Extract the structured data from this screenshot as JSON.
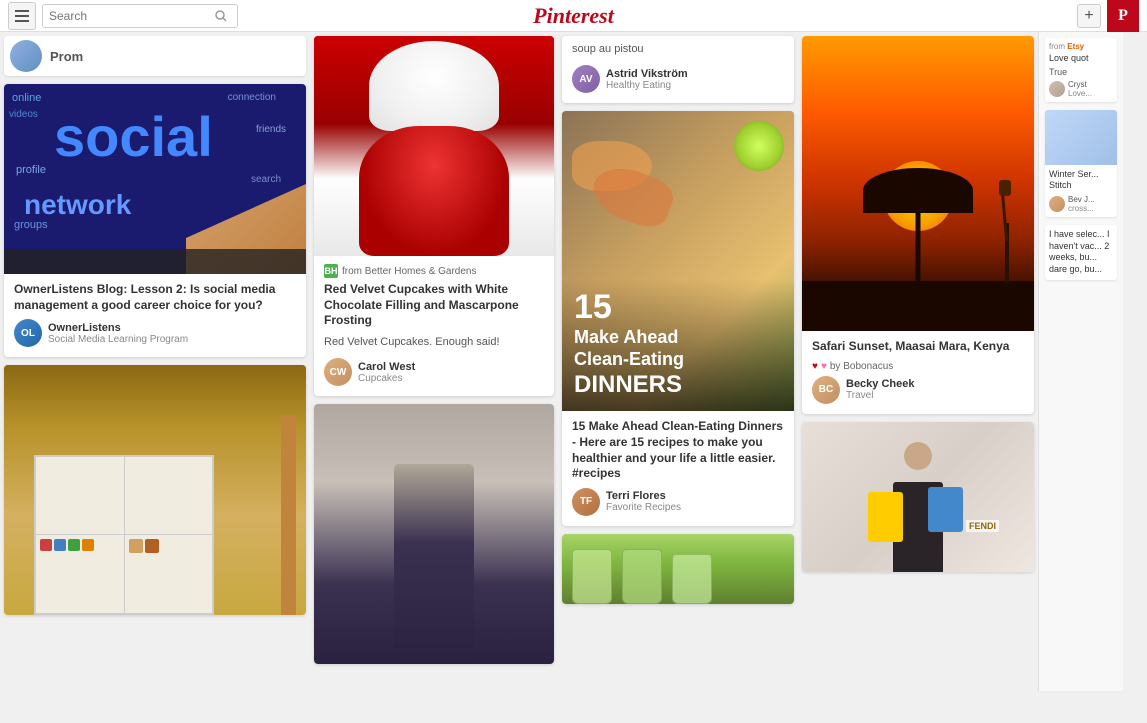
{
  "nav": {
    "search_placeholder": "Search",
    "logo": "Pinterest",
    "logo_stylized": "Pinterest"
  },
  "prom_user": {
    "name": "Prom"
  },
  "col1": {
    "card1": {
      "title": "OwnerListens Blog: Lesson 2: Is social media management a good career choice for you?",
      "user_name": "OwnerListens",
      "user_board": "Social Media Learning Program"
    }
  },
  "col2": {
    "card1": {
      "source_from": "from",
      "source_name": "Better Homes & Gardens",
      "title": "Red Velvet Cupcakes with White Chocolate Filling and Mascarpone Frosting",
      "desc": "Red Velvet Cupcakes. Enough said!",
      "user_name": "Carol West",
      "user_board": "Cupcakes"
    }
  },
  "col3": {
    "card0": {
      "text": "soup au pistou"
    },
    "card0_user": {
      "name": "Astrid Vikström",
      "board": "Healthy Eating"
    },
    "card1": {
      "shrimp_num": "15",
      "shrimp_label": "Make Ahead\nClean-Eating\nDINNERS",
      "title": "15 Make Ahead Clean-Eating Dinners - Here are 15 recipes to make you healthier and your life a little easier. #recipes",
      "user_name": "Terri Flores",
      "user_board": "Favorite Recipes"
    },
    "card2": {
      "text": "jars"
    }
  },
  "col4": {
    "card1": {
      "title": "Safari Sunset, Maasai Mara, Kenya",
      "by": "by Bobonacus",
      "user_name": "Becky Cheek",
      "user_board": "Travel"
    },
    "card2": {
      "text": "shopping"
    }
  },
  "right_panel": {
    "card1": {
      "source_from": "from",
      "source_name": "Etsy",
      "title": "Love quot",
      "body": "True",
      "user_name": "Cryst",
      "user_board": "Love..."
    },
    "card2": {
      "title": "Winter Ser...",
      "subtitle": "Stitch",
      "user_name": "Bev J...",
      "user_board": "cross..."
    },
    "card3": {
      "body": "I have selec... I haven't vac... 2 weeks, bu... dare go, bu..."
    }
  }
}
